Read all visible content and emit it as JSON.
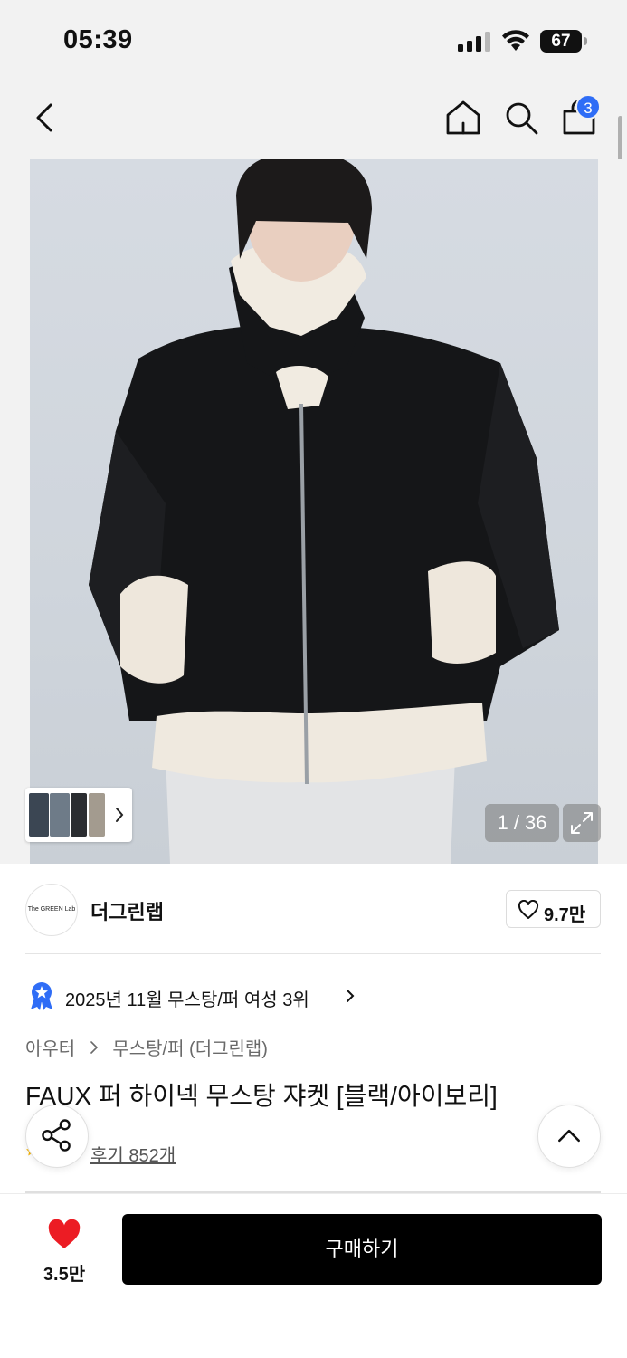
{
  "status_bar": {
    "time": "05:39",
    "battery": "67"
  },
  "nav": {
    "cart_badge": "3"
  },
  "gallery": {
    "page_counter": "1 / 36"
  },
  "brand": {
    "logo_text": "The GREEN Lab",
    "name": "더그린랩",
    "like_count": "9.7만"
  },
  "ranking": {
    "text": "2025년 11월 무스탕/퍼 여성 3위"
  },
  "breadcrumb": {
    "level1": "아우터",
    "level2": "무스탕/퍼 (더그린랩)"
  },
  "product": {
    "title": "FAUX 퍼 하이넥 무스탕 쟈켓 [블랙/아이보리]",
    "review_label": "후기 852개"
  },
  "bottom_bar": {
    "like_count": "3.5만",
    "buy_label": "구매하기"
  },
  "colors": {
    "accent_blue": "#2f6df6",
    "heart_red": "#ec1c24",
    "buy_button": "#000000"
  }
}
